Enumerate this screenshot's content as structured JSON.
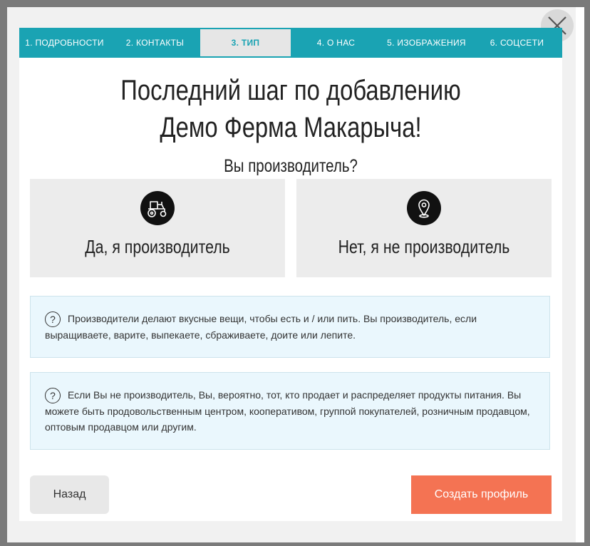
{
  "steps": [
    {
      "label": "1. ПОДРОБНОСТИ",
      "active": false
    },
    {
      "label": "2. КОНТАКТЫ",
      "active": false
    },
    {
      "label": "3. ТИП",
      "active": true
    },
    {
      "label": "4. О НАС",
      "active": false
    },
    {
      "label": "5. ИЗОБРАЖЕНИЯ",
      "active": false
    },
    {
      "label": "6. СОЦСЕТИ",
      "active": false
    }
  ],
  "title": "Последний шаг по добавлению Демо Ферма Макарыча!",
  "subtitle": "Вы производитель?",
  "choices": {
    "yes": {
      "label": "Да, я производитель",
      "icon": "tractor-icon"
    },
    "no": {
      "label": "Нет, я не производитель",
      "icon": "map-pin-icon"
    }
  },
  "info": {
    "producer": "Производители делают вкусные вещи, чтобы есть и / или пить. Вы производитель, если выращиваете, варите, выпекаете, сбраживаете, доите или лепите.",
    "non_producer": "Если Вы не производитель, Вы, вероятно, тот, кто продает и распределяет продукты питания. Вы можете быть продовольственным центром, кооперативом, группой покупателей, розничным продавцом, оптовым продавцом или другим.",
    "question_glyph": "?"
  },
  "buttons": {
    "back": "Назад",
    "create": "Создать профиль"
  },
  "colors": {
    "accent": "#1aa3b3",
    "primary_button": "#f47353",
    "info_background": "#eaf7fd"
  }
}
